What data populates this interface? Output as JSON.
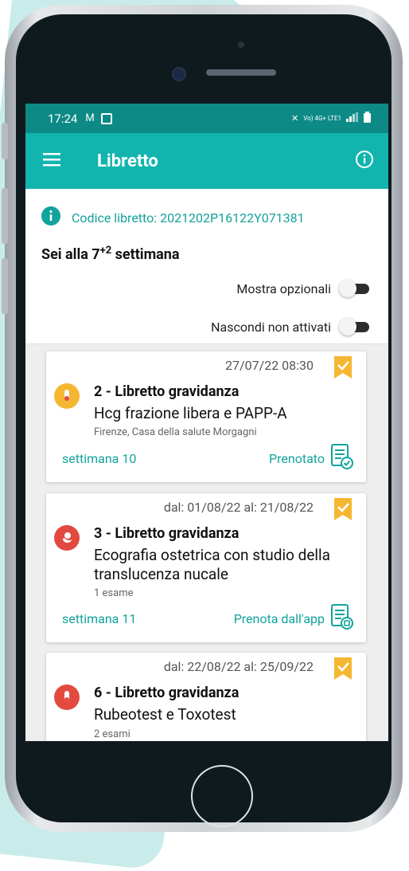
{
  "status_bar": {
    "time": "17:24",
    "network": "Vo) 4G+ LTE1"
  },
  "app_bar": {
    "title": "Libretto"
  },
  "header": {
    "codice_label": "Codice libretto: 2021202P16122Y071381",
    "week_prefix": "Sei alla 7",
    "week_sup": "+2",
    "week_suffix": " settimana",
    "toggles": [
      {
        "label": "Mostra opzionali",
        "on": false
      },
      {
        "label": "Nascondi non attivati",
        "on": false
      }
    ]
  },
  "cards": [
    {
      "date": "27/07/22 08:30",
      "title": "2 - Libretto gravidanza",
      "description": "Hcg frazione libera e PAPP-A",
      "subtitle": "Firenze, Casa della salute Morgagni",
      "week": "settimana 10",
      "action": "Prenotato",
      "avatar_color": "#f5b731",
      "avatar_icon": "test-tube-icon"
    },
    {
      "date": "dal: 01/08/22 al: 21/08/22",
      "title": "3 - Libretto gravidanza",
      "description": "Ecografia ostetrica con studio della translucenza nucale",
      "subtitle": "1 esame",
      "week": "settimana 11",
      "action": "Prenota dall'app",
      "avatar_color": "#e24a40",
      "avatar_icon": "fetus-icon"
    },
    {
      "date": "dal: 22/08/22 al: 25/09/22",
      "title": "6 - Libretto gravidanza",
      "description": "Rubeotest e Toxotest",
      "subtitle": "2 esami",
      "avatar_color": "#e24a40",
      "avatar_icon": "test-tube-icon"
    }
  ],
  "colors": {
    "teal": "#12b5ae",
    "teal_dark": "#0d8a86",
    "bookmark": "#f5b731"
  }
}
